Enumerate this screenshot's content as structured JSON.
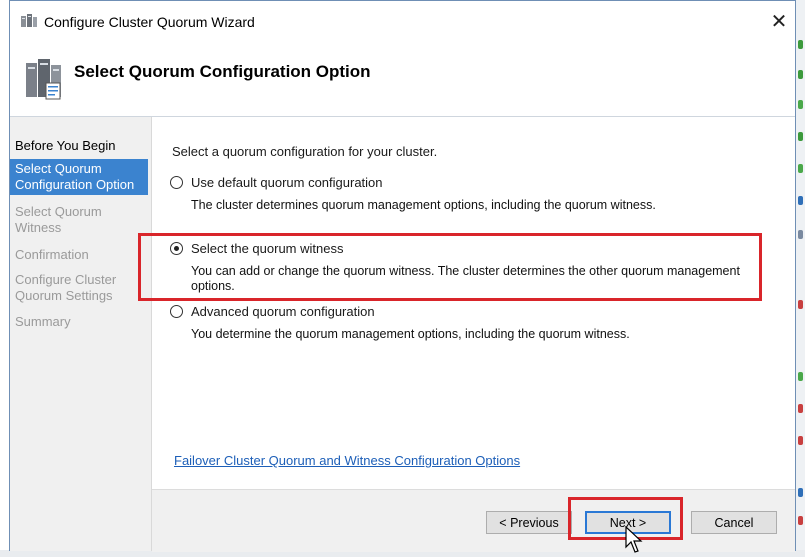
{
  "window": {
    "title": "Configure Cluster Quorum Wizard",
    "close_glyph": "✕"
  },
  "header": {
    "title": "Select Quorum Configuration Option",
    "icon": "cluster-servers-icon"
  },
  "nav": {
    "items": [
      {
        "label": "Before You Begin",
        "state": "done"
      },
      {
        "label": "Select Quorum Configuration Option",
        "state": "active"
      },
      {
        "label": "Select Quorum Witness",
        "state": "pending"
      },
      {
        "label": "Confirmation",
        "state": "pending"
      },
      {
        "label": "Configure Cluster Quorum Settings",
        "state": "pending"
      },
      {
        "label": "Summary",
        "state": "pending"
      }
    ]
  },
  "content": {
    "prompt": "Select a quorum configuration for your cluster.",
    "options": [
      {
        "label": "Use default quorum configuration",
        "description": "The cluster determines quorum management options, including the quorum witness.",
        "selected": false
      },
      {
        "label": "Select the quorum witness",
        "description": "You can add or change the quorum witness. The cluster determines the other quorum management options.",
        "selected": true
      },
      {
        "label": "Advanced quorum configuration",
        "description": "You determine the quorum management options, including the quorum witness.",
        "selected": false
      }
    ],
    "help_link": "Failover Cluster Quorum and Witness Configuration Options"
  },
  "footer": {
    "previous_label": "< Previous",
    "next_label": "Next >",
    "cancel_label": "Cancel"
  },
  "colors": {
    "active_nav": "#3b83cf",
    "link": "#1d5fb8",
    "highlight": "#d9252a"
  }
}
